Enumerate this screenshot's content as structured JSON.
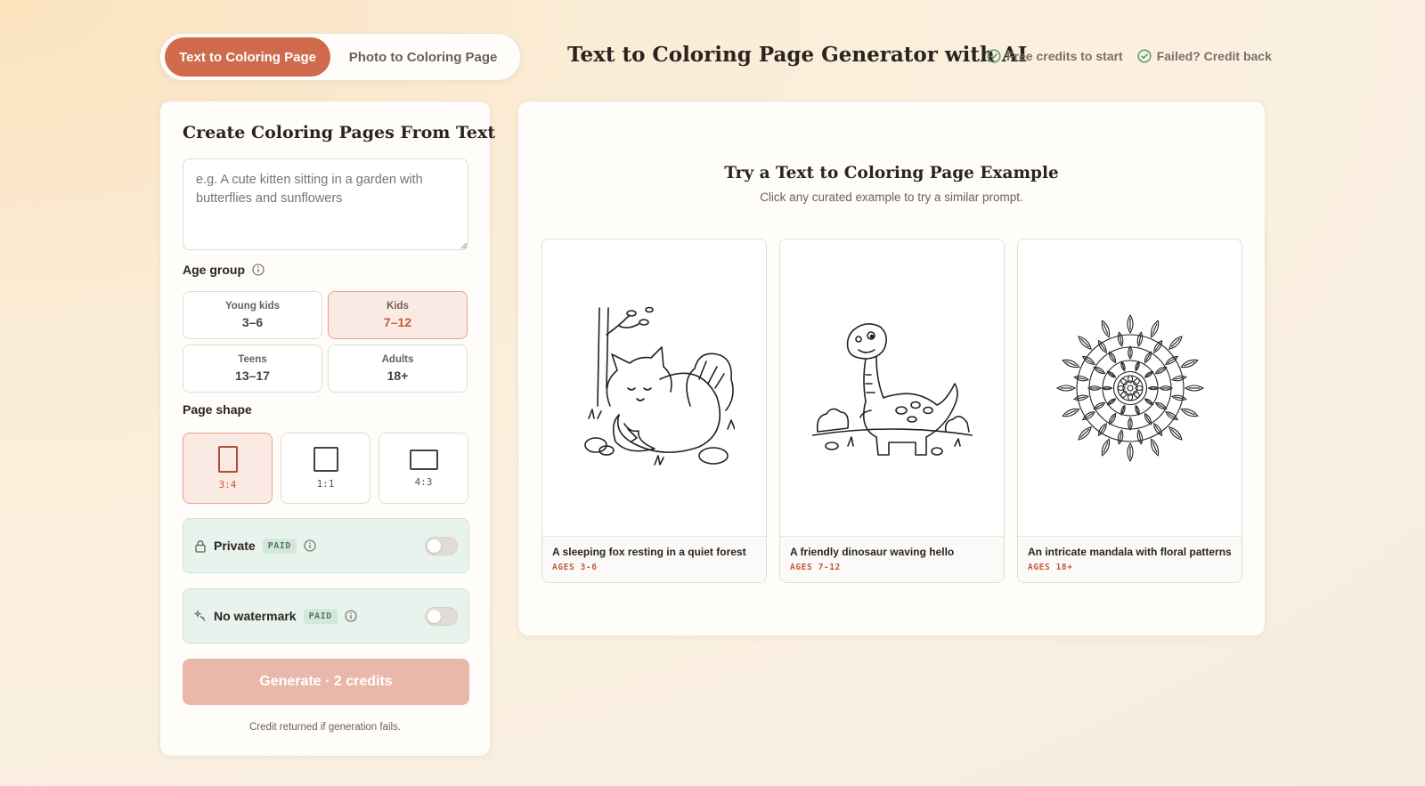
{
  "modes": [
    {
      "label": "Text to Coloring Page",
      "active": true
    },
    {
      "label": "Photo to Coloring Page",
      "active": false
    }
  ],
  "header": {
    "title": "Text to Coloring Page Generator with AI",
    "perks": [
      "Free credits to start",
      "Failed? Credit back"
    ]
  },
  "form": {
    "title": "Create Coloring Pages From Text",
    "prompt_placeholder": "e.g. A cute kitten sitting in a garden with butterflies and sunflowers",
    "age_label": "Age group",
    "ages": [
      {
        "sub": "Young kids",
        "value": "3–6",
        "selected": false
      },
      {
        "sub": "Kids",
        "value": "7–12",
        "selected": true
      },
      {
        "sub": "Teens",
        "value": "13–17",
        "selected": false
      },
      {
        "sub": "Adults",
        "value": "18+",
        "selected": false
      }
    ],
    "shape_label": "Page shape",
    "shapes": [
      {
        "label": "3:4",
        "selected": true
      },
      {
        "label": "1:1",
        "selected": false
      },
      {
        "label": "4:3",
        "selected": false
      }
    ],
    "private": {
      "label": "Private",
      "badge": "PAID",
      "on": false
    },
    "watermark": {
      "label": "No watermark",
      "badge": "PAID",
      "on": false
    },
    "generate_label": "Generate · 2 credits",
    "credit_note": "Credit returned if generation fails."
  },
  "examples": {
    "title": "Try a Text to Coloring Page Example",
    "subtitle": "Click any curated example to try a similar prompt.",
    "items": [
      {
        "caption": "A sleeping fox resting in a quiet forest",
        "age": "AGES 3-6",
        "icon": "fox-illustration"
      },
      {
        "caption": "A friendly dinosaur waving hello",
        "age": "AGES 7-12",
        "icon": "dinosaur-illustration"
      },
      {
        "caption": "An intricate mandala with floral patterns",
        "age": "AGES 18+",
        "icon": "mandala-illustration"
      }
    ]
  },
  "colors": {
    "accent": "#cf6a4d",
    "accent_soft": "#fbeae3",
    "paid_green": "#e9f3ee",
    "generate_disabled": "#e9b8aa"
  }
}
